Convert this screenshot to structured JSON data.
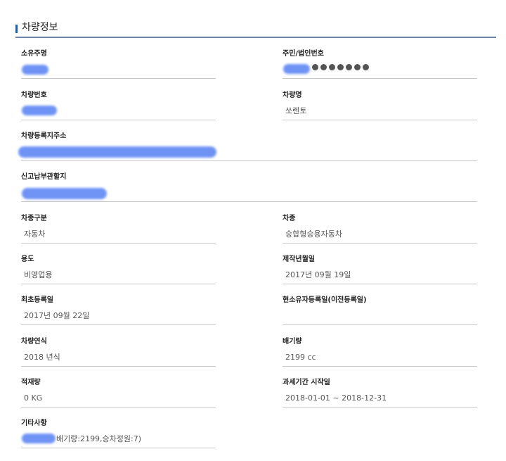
{
  "section": {
    "title": "차량정보"
  },
  "fields": {
    "owner_name": {
      "label": "소유주명",
      "value": ""
    },
    "resident_id": {
      "label": "주민/법인번호",
      "value": "●●●●●●●"
    },
    "plate_number": {
      "label": "차량번호",
      "value": ""
    },
    "vehicle_name": {
      "label": "차량명",
      "value": "쏘렌토"
    },
    "reg_address": {
      "label": "차량등록지주소",
      "value": ""
    },
    "tax_office": {
      "label": "신고납부관할지",
      "value": ""
    },
    "vehicle_class": {
      "label": "차종구분",
      "value": "자동차"
    },
    "vehicle_type": {
      "label": "차종",
      "value": "승합형승용자동차"
    },
    "usage": {
      "label": "용도",
      "value": "비영업용"
    },
    "manufacture_date": {
      "label": "제작년월일",
      "value": "2017년 09월 19일"
    },
    "first_reg_date": {
      "label": "최초등록일",
      "value": "2017년 09월 22일"
    },
    "current_owner_reg_date": {
      "label": "현소유자등록일(이전등록일)",
      "value": ""
    },
    "model_year": {
      "label": "차량연식",
      "value": "2018 년식"
    },
    "displacement": {
      "label": "배기량",
      "value": "2199 cc"
    },
    "load_capacity": {
      "label": "적재량",
      "value": "0 KG"
    },
    "tax_period_start": {
      "label": "과세기간 시작일",
      "value": "2018-01-01 ~ 2018-12-31"
    },
    "notes": {
      "label": "기타사항",
      "value": "배기량:2199,승차정원:7)"
    }
  }
}
